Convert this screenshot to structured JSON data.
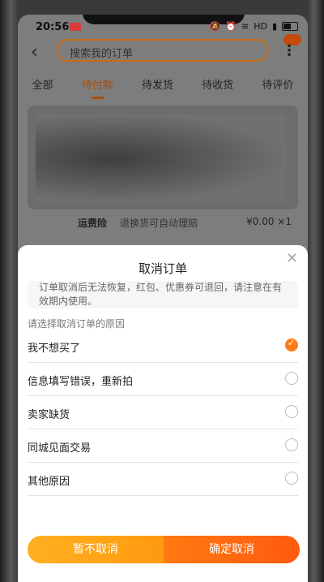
{
  "status_bar": {
    "time": "20:56",
    "network": "HD",
    "icons": [
      "recording-icon",
      "mute-icon",
      "alarm-icon",
      "wifi-icon",
      "signal-icon",
      "battery-icon"
    ]
  },
  "header": {
    "search_placeholder": "搜索我的订单"
  },
  "tabs": [
    {
      "label": "全部",
      "active": false
    },
    {
      "label": "待付款",
      "active": true
    },
    {
      "label": "待发货",
      "active": false
    },
    {
      "label": "待收货",
      "active": false
    },
    {
      "label": "待评价",
      "active": false
    }
  ],
  "order": {
    "freight_label": "运费险",
    "freight_desc": "退换货可自动理赔",
    "price": "¥0.00 ×1"
  },
  "dialog": {
    "title": "取消订单",
    "notice": "订单取消后无法恢复，红包、优惠券可退回，请注意在有效期内使用。",
    "prompt": "请选择取消订单的原因",
    "reasons": [
      {
        "label": "我不想买了",
        "selected": true
      },
      {
        "label": "信息填写错误，重新拍",
        "selected": false
      },
      {
        "label": "卖家缺货",
        "selected": false
      },
      {
        "label": "同城见面交易",
        "selected": false
      },
      {
        "label": "其他原因",
        "selected": false
      }
    ],
    "cancel_label": "暂不取消",
    "confirm_label": "确定取消"
  },
  "colors": {
    "accent": "#ff7a18",
    "tab_active": "#a84c05",
    "overlay": "#7d7d7d"
  }
}
